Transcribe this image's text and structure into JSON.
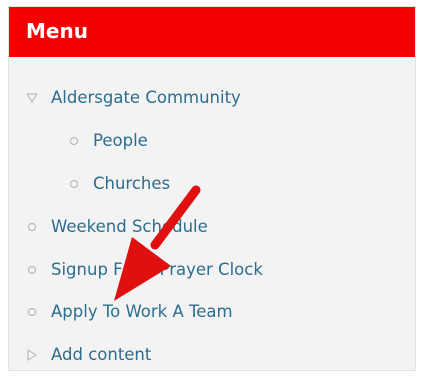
{
  "menu": {
    "title": "Menu",
    "items": [
      {
        "label": "Aldersgate Community",
        "bullet": "triangle-down-icon"
      },
      {
        "label": "People",
        "bullet": "circle-bullet-icon"
      },
      {
        "label": "Churches",
        "bullet": "circle-bullet-icon"
      },
      {
        "label": "Weekend Schedule",
        "bullet": "circle-bullet-icon"
      },
      {
        "label": "Signup For a Prayer Clock",
        "bullet": "circle-bullet-icon"
      },
      {
        "label": "Apply To Work A Team",
        "bullet": "circle-bullet-icon"
      },
      {
        "label": "Add content",
        "bullet": "triangle-right-icon"
      }
    ]
  },
  "colors": {
    "header_bg": "#f50000",
    "header_text": "#ffffff",
    "panel_bg": "#f2f3f2",
    "link_text": "#2d6d8e",
    "bullet": "#b2b2b2",
    "annotation_arrow": "#e01010"
  },
  "annotation": {
    "icon": "red-arrow-icon"
  }
}
